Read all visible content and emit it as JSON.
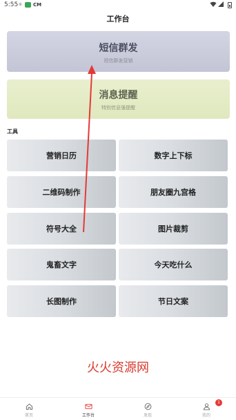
{
  "status_bar": {
    "time": "5:55",
    "notif_icon": "✳",
    "app_icon": "CM"
  },
  "header": {
    "title": "工作台"
  },
  "banners": [
    {
      "title": "短信群发",
      "subtitle": "短信群发营销"
    },
    {
      "title": "消息提醒",
      "subtitle": "特别信息强提醒"
    }
  ],
  "tools": {
    "section_label": "工具",
    "items": [
      "营销日历",
      "数字上下标",
      "二维码制作",
      "朋友圈九宫格",
      "符号大全",
      "图片裁剪",
      "鬼畜文字",
      "今天吃什么",
      "长图制作",
      "节日文案"
    ]
  },
  "watermark": "火火资源网",
  "tab_bar": {
    "items": [
      {
        "label": "首页",
        "icon": "home-icon"
      },
      {
        "label": "工作台",
        "icon": "mail-icon"
      },
      {
        "label": "发现",
        "icon": "compass-icon"
      },
      {
        "label": "我的",
        "icon": "user-icon",
        "badge": "1"
      }
    ]
  },
  "colors": {
    "accent_red": "#e53935",
    "watermark_red": "#d93a2e",
    "banner_sms": "#c9cbdb",
    "banner_msg": "#e3ebc4"
  }
}
